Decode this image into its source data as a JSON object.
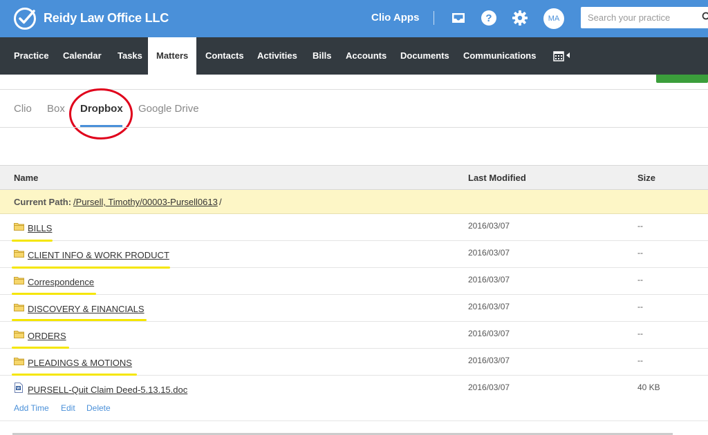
{
  "header": {
    "firm_name": "Reidy Law Office LLC",
    "apps_label": "Clio Apps",
    "avatar_initials": "MA",
    "search_placeholder": "Search your practice",
    "icons": [
      "check-logo-icon",
      "inbox-icon",
      "help-icon",
      "gear-icon",
      "search-icon"
    ]
  },
  "nav": {
    "items": [
      "Practice",
      "Calendar",
      "Tasks",
      "Matters",
      "Contacts",
      "Activities",
      "Bills",
      "Accounts",
      "Documents",
      "Communications"
    ],
    "active": "Matters",
    "icons": [
      "calendar-icon",
      "caret-left-icon"
    ]
  },
  "tabs": {
    "items": [
      "Clio",
      "Box",
      "Dropbox",
      "Google Drive"
    ],
    "active": "Dropbox"
  },
  "table": {
    "columns": [
      "Name",
      "Last Modified",
      "Size"
    ],
    "current_path_label": "Current Path:",
    "current_path": "/Pursell, Timothy/00003-Pursell0613",
    "current_path_tail": "/",
    "rows": [
      {
        "name": "BILLS",
        "modified": "2016/03/07",
        "size": "--",
        "type": "folder"
      },
      {
        "name": "CLIENT INFO & WORK PRODUCT",
        "modified": "2016/03/07",
        "size": "--",
        "type": "folder"
      },
      {
        "name": "Correspondence",
        "modified": "2016/03/07",
        "size": "--",
        "type": "folder"
      },
      {
        "name": "DISCOVERY & FINANCIALS",
        "modified": "2016/03/07",
        "size": "--",
        "type": "folder"
      },
      {
        "name": "ORDERS",
        "modified": "2016/03/07",
        "size": "--",
        "type": "folder"
      },
      {
        "name": "PLEADINGS & MOTIONS",
        "modified": "2016/03/07",
        "size": "--",
        "type": "folder"
      },
      {
        "name": "PURSELL-Quit Claim Deed-5.13.15.doc",
        "modified": "2016/03/07",
        "size": "40 KB",
        "type": "file"
      }
    ],
    "file_actions": [
      "Add Time",
      "Edit",
      "Delete"
    ]
  },
  "colors": {
    "header_blue": "#4a90d9",
    "nav_dark": "#333a40",
    "path_yellow": "#fdf6c6",
    "highlight_yellow": "#f5e600",
    "annotation_red": "#e0001b",
    "action_green": "#3b9e3b"
  }
}
